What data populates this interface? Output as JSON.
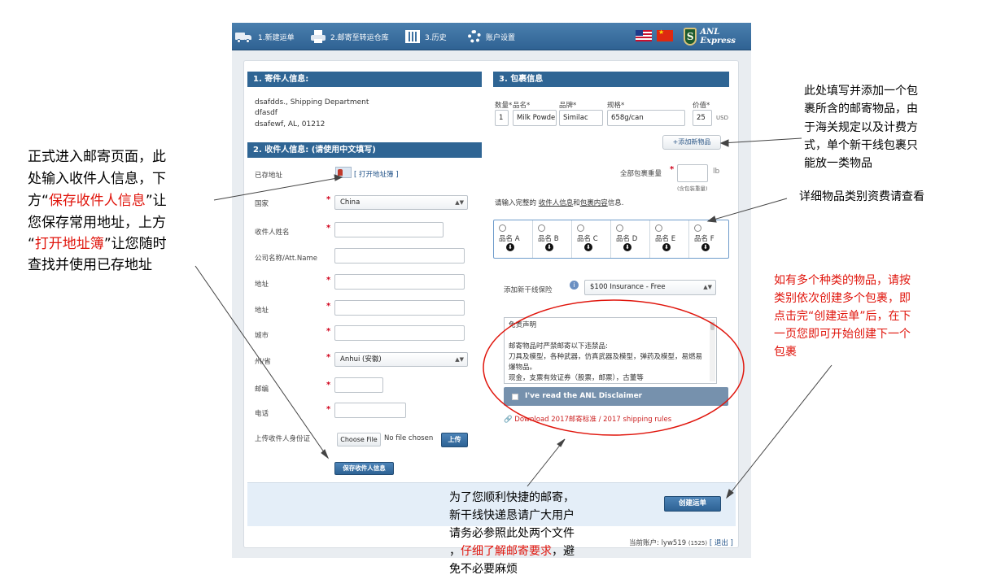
{
  "nav": {
    "items": [
      "1.新建运单",
      "2.邮寄至转运仓库",
      "3.历史",
      "账户设置"
    ],
    "logo_text": "ANL Express",
    "logo_letter": "S"
  },
  "sender": {
    "header": "1. 寄件人信息:",
    "lines": [
      "dsafdds., Shipping Department",
      "dfasdf",
      "dsafewf, AL, 01212"
    ]
  },
  "receiver": {
    "header": "2. 收件人信息: (请使用中文填写)",
    "saved_label": "已存地址",
    "open_book_link": "[ 打开地址簿 ]",
    "fields": [
      {
        "label": "国家",
        "value": "China",
        "required": "*",
        "type": "select"
      },
      {
        "label": "收件人姓名",
        "value": "",
        "required": "*",
        "type": "text"
      },
      {
        "label": "公司名称/Att.Name",
        "value": "",
        "required": "",
        "type": "text"
      },
      {
        "label": "地址",
        "value": "",
        "required": "*",
        "type": "text"
      },
      {
        "label": "地址",
        "value": "",
        "required": "*",
        "type": "text"
      },
      {
        "label": "城市",
        "value": "",
        "required": "*",
        "type": "text"
      },
      {
        "label": "州/省",
        "value": "Anhui (安徽)",
        "required": "*",
        "type": "select"
      },
      {
        "label": "邮编",
        "value": "",
        "required": "*",
        "type": "text"
      },
      {
        "label": "电话",
        "value": "",
        "required": "*",
        "type": "text"
      }
    ],
    "upload_label": "上传收件人身份证",
    "choose_file": "Choose File",
    "no_file": "No file chosen",
    "upload_btn": "上传",
    "save_btn": "保存收件人信息"
  },
  "package": {
    "header": "3. 包裹信息",
    "col_qty": "数量*",
    "col_name": "品名*",
    "col_brand": "品牌*",
    "col_spec": "规格*",
    "col_value": "价值*",
    "qty": "1",
    "name": "Milk Powder",
    "brand": "Similac",
    "spec": "658g/can",
    "value": "25",
    "currency": "USD",
    "add_item_btn": "+添加新物品",
    "weight_label": "全部包裹重量",
    "weight_req": "*",
    "weight_unit": "lb",
    "weight_note": "(含包装重量)",
    "prompt_prefix": "请输入完整的",
    "prompt_link1": "收件人信息",
    "prompt_and": "和",
    "prompt_link2": "包裹内容",
    "prompt_suffix": "信息.",
    "categories": [
      "品名 A",
      "品名 B",
      "品名 C",
      "品名 D",
      "品名 E",
      "品名 F"
    ],
    "dl_glyph": "⬇",
    "insurance_label": "添加新干线保险",
    "insurance_value": "$100 Insurance - Free",
    "disclaimer_lines": [
      "免责声明",
      "",
      "邮寄物品时严禁邮寄以下违禁品:",
      "刀具及模型，各种武器，仿真武器及模型，弹药及模型，易燃易爆物品。",
      "现金，支票有效证券（股票，邮票），古董等"
    ],
    "disclaimer_check": "I've read the ANL Disclaimer",
    "download_link": "Download 2017邮寄标准 / 2017 shipping rules"
  },
  "create_btn": "创建运单",
  "account": "当前账户: lyw519",
  "account_id": "(1525)",
  "logout": "[ 退出 ]",
  "annotations": {
    "left_lines": [
      "正式进入邮寄页面，此",
      "处输入收件人信息，下"
    ],
    "left_l3_a": "方“",
    "left_l3_red": "保存收件人信息",
    "left_l3_b": "”让",
    "left_l4": "您保存常用地址，上方",
    "left_l5_a": "“",
    "left_l5_red": "打开地址簿",
    "left_l5_b": "”让您随时",
    "left_l6": "查找并使用已存地址",
    "right_top": [
      "此处填写并添加一个包",
      "裹所含的邮寄物品，由",
      "于海关规定以及计费方",
      "式，单个新干线包裹只",
      "能放一类物品"
    ],
    "right_mid": "详细物品类别资费请查看",
    "right_red": [
      "如有多个种类的物品，请按",
      "类别依次创建多个包裹，即",
      "点击完“创建运单”后，在下",
      "一页您即可开始创建下一个",
      "包裹"
    ],
    "bottom_l1": "为了您顺利快捷的邮寄，",
    "bottom_l2": "新干线快递恳请广大用户",
    "bottom_l3": "请务必参照此处两个文件",
    "bottom_l4_a": "，",
    "bottom_l4_red": "仔细了解邮寄要求",
    "bottom_l4_b": "，避",
    "bottom_l5": "免不必要麻烦"
  }
}
